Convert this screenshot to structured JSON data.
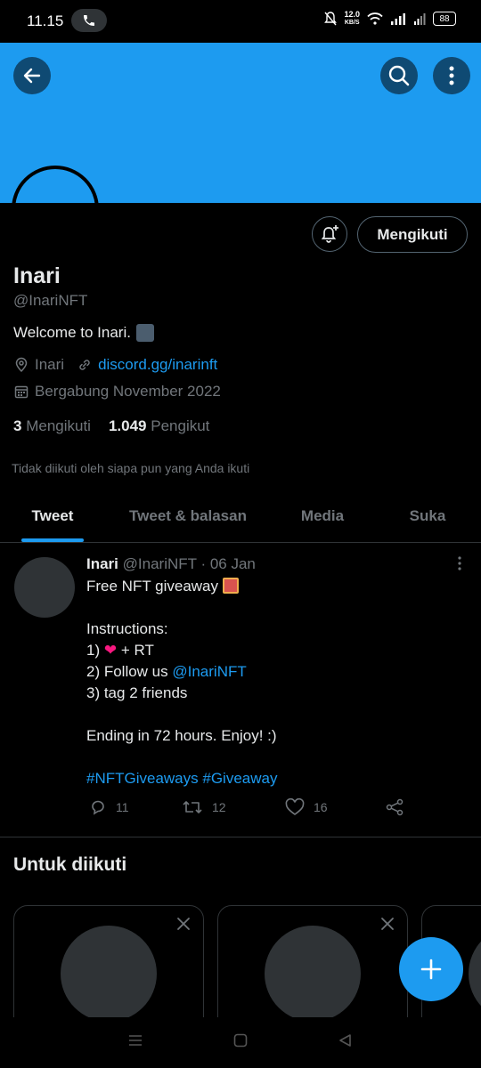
{
  "status_bar": {
    "time": "11.15",
    "net_speed_value": "12.0",
    "net_speed_unit": "KB/S",
    "battery": "88"
  },
  "profile": {
    "name": "Inari",
    "handle": "@InariNFT",
    "bio": "Welcome to Inari.",
    "location": "Inari",
    "website": "discord.gg/inarinft",
    "joined": "Bergabung November 2022",
    "following_count": "3",
    "following_label": "Mengikuti",
    "followers_count": "1.049",
    "followers_label": "Pengikut",
    "not_followed_note": "Tidak diikuti oleh siapa pun yang Anda ikuti",
    "follow_button": "Mengikuti"
  },
  "tabs": [
    {
      "label": "Tweet",
      "active": true
    },
    {
      "label": "Tweet & balasan",
      "active": false
    },
    {
      "label": "Media",
      "active": false
    },
    {
      "label": "Suka",
      "active": false
    }
  ],
  "tweet": {
    "author": "Inari",
    "handle": "@InariNFT",
    "date": "· 06 Jan",
    "line1": "Free NFT giveaway",
    "line2": "Instructions:",
    "line3_a": "1)",
    "line3_b": "+ RT",
    "line4_a": "2) Follow us",
    "line4_mention": "@InariNFT",
    "line5": "3) tag 2 friends",
    "line6": "Ending in 72 hours. Enjoy! :)",
    "hashtags": "#NFTGiveaways #Giveaway",
    "replies": "11",
    "retweets": "12",
    "likes": "16"
  },
  "who_to_follow": {
    "title": "Untuk diikuti"
  },
  "colors": {
    "accent": "#1d9bf0",
    "background": "#000000",
    "secondary_text": "#71767b",
    "heart": "#f91880"
  }
}
